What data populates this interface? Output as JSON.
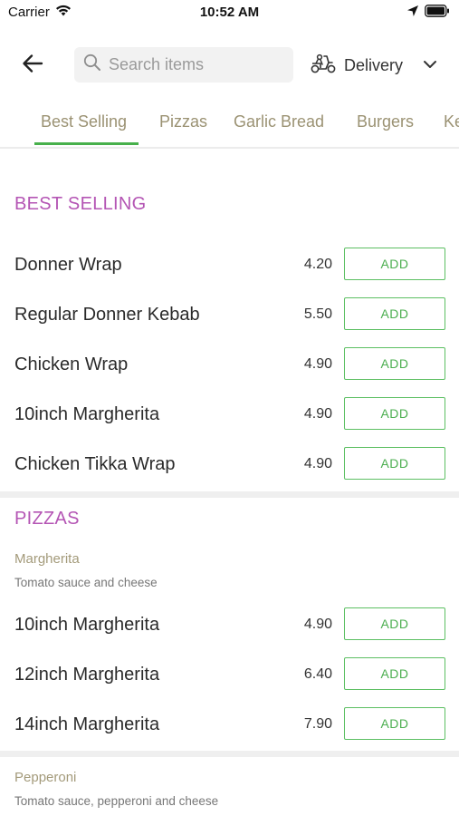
{
  "status_bar": {
    "carrier": "Carrier",
    "time": "10:52 AM",
    "icons": [
      "wifi-icon",
      "location-arrow-icon",
      "battery-icon"
    ]
  },
  "header": {
    "back_icon": "arrow-left-icon",
    "search": {
      "placeholder": "Search items",
      "value": "",
      "icon": "search-icon"
    },
    "delivery": {
      "label": "Delivery",
      "icon": "scooter-icon",
      "chevron": "chevron-down-icon"
    }
  },
  "tabs": [
    {
      "label": "Best Selling",
      "active": true
    },
    {
      "label": "Pizzas",
      "active": false
    },
    {
      "label": "Garlic Bread",
      "active": false
    },
    {
      "label": "Burgers",
      "active": false
    },
    {
      "label": "Ke",
      "active": false
    }
  ],
  "colors": {
    "accent_green": "#47b04b",
    "section_title": "#b455b4",
    "tab_text": "#9b9273",
    "group_title": "#a39a7a"
  },
  "sections": [
    {
      "title": "BEST SELLING",
      "items": [
        {
          "name": "Donner Wrap",
          "price": "4.20",
          "button": "ADD"
        },
        {
          "name": "Regular Donner Kebab",
          "price": "5.50",
          "button": "ADD"
        },
        {
          "name": "Chicken Wrap",
          "price": "4.90",
          "button": "ADD"
        },
        {
          "name": "10inch Margherita",
          "price": "4.90",
          "button": "ADD"
        },
        {
          "name": "Chicken Tikka Wrap",
          "price": "4.90",
          "button": "ADD"
        }
      ]
    },
    {
      "title": "PIZZAS",
      "groups": [
        {
          "name": "Margherita",
          "description": "Tomato sauce and cheese",
          "items": [
            {
              "name": "10inch Margherita",
              "price": "4.90",
              "button": "ADD"
            },
            {
              "name": "12inch Margherita",
              "price": "6.40",
              "button": "ADD"
            },
            {
              "name": "14inch Margherita",
              "price": "7.90",
              "button": "ADD"
            }
          ]
        },
        {
          "name": "Pepperoni",
          "description": "Tomato sauce, pepperoni and cheese",
          "items": []
        }
      ]
    }
  ]
}
